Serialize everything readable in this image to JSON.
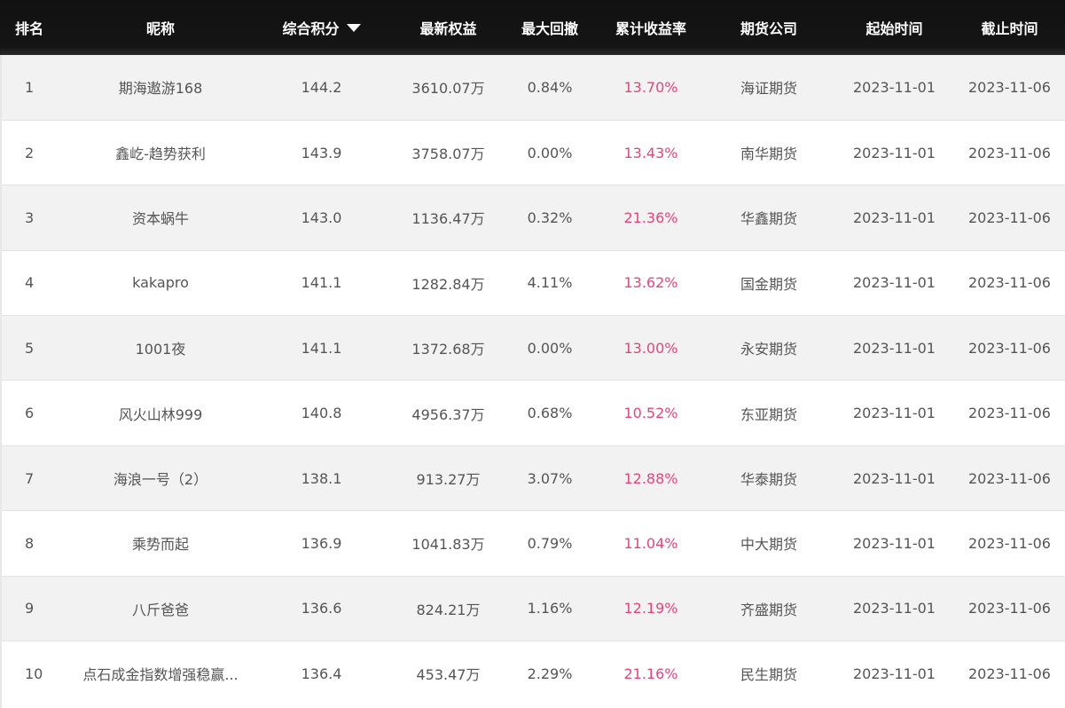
{
  "header": {
    "rank": "排名",
    "nickname": "昵称",
    "score": "综合积分",
    "equity": "最新权益",
    "drawdown": "最大回撤",
    "return_rate": "累计收益率",
    "company": "期货公司",
    "start": "起始时间",
    "end": "截止时间"
  },
  "sort_icon": "caret-down-icon",
  "colors": {
    "header_bg": "#111111",
    "row_alt_bg": "#f2f2f2",
    "return_rate": "#e6457a",
    "text": "#555555"
  },
  "rows": [
    {
      "rank": "1",
      "nickname": "期海遨游168",
      "score": "144.2",
      "equity": "3610.07万",
      "drawdown": "0.84%",
      "return_rate": "13.70%",
      "company": "海证期货",
      "start": "2023-11-01",
      "end": "2023-11-06"
    },
    {
      "rank": "2",
      "nickname": "鑫屹-趋势获利",
      "score": "143.9",
      "equity": "3758.07万",
      "drawdown": "0.00%",
      "return_rate": "13.43%",
      "company": "南华期货",
      "start": "2023-11-01",
      "end": "2023-11-06"
    },
    {
      "rank": "3",
      "nickname": "资本蜗牛",
      "score": "143.0",
      "equity": "1136.47万",
      "drawdown": "0.32%",
      "return_rate": "21.36%",
      "company": "华鑫期货",
      "start": "2023-11-01",
      "end": "2023-11-06"
    },
    {
      "rank": "4",
      "nickname": "kakapro",
      "score": "141.1",
      "equity": "1282.84万",
      "drawdown": "4.11%",
      "return_rate": "13.62%",
      "company": "国金期货",
      "start": "2023-11-01",
      "end": "2023-11-06"
    },
    {
      "rank": "5",
      "nickname": "1001夜",
      "score": "141.1",
      "equity": "1372.68万",
      "drawdown": "0.00%",
      "return_rate": "13.00%",
      "company": "永安期货",
      "start": "2023-11-01",
      "end": "2023-11-06"
    },
    {
      "rank": "6",
      "nickname": "风火山林999",
      "score": "140.8",
      "equity": "4956.37万",
      "drawdown": "0.68%",
      "return_rate": "10.52%",
      "company": "东亚期货",
      "start": "2023-11-01",
      "end": "2023-11-06"
    },
    {
      "rank": "7",
      "nickname": "海浪一号（2）",
      "score": "138.1",
      "equity": "913.27万",
      "drawdown": "3.07%",
      "return_rate": "12.88%",
      "company": "华泰期货",
      "start": "2023-11-01",
      "end": "2023-11-06"
    },
    {
      "rank": "8",
      "nickname": "乘势而起",
      "score": "136.9",
      "equity": "1041.83万",
      "drawdown": "0.79%",
      "return_rate": "11.04%",
      "company": "中大期货",
      "start": "2023-11-01",
      "end": "2023-11-06"
    },
    {
      "rank": "9",
      "nickname": "八斤爸爸",
      "score": "136.6",
      "equity": "824.21万",
      "drawdown": "1.16%",
      "return_rate": "12.19%",
      "company": "齐盛期货",
      "start": "2023-11-01",
      "end": "2023-11-06"
    },
    {
      "rank": "10",
      "nickname": "点石成金指数增强稳赢...",
      "score": "136.4",
      "equity": "453.47万",
      "drawdown": "2.29%",
      "return_rate": "21.16%",
      "company": "民生期货",
      "start": "2023-11-01",
      "end": "2023-11-06"
    }
  ]
}
